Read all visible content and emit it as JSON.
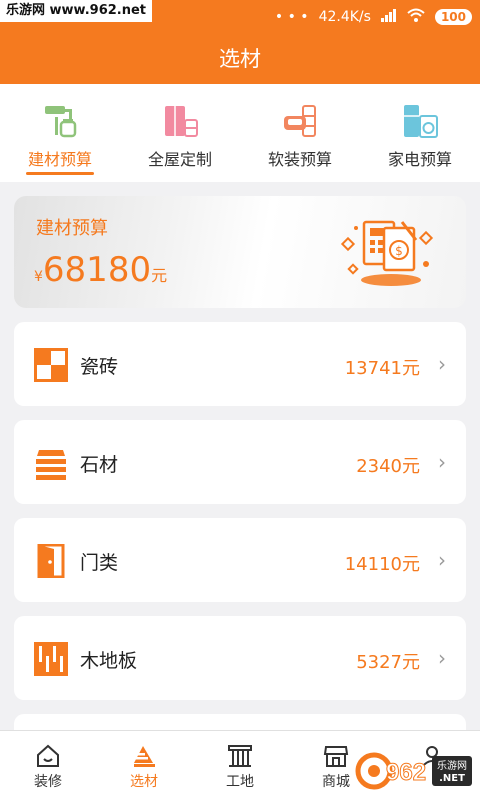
{
  "statusbar": {
    "watermark": "乐游网 www.962.net",
    "network_speed": "42.4K/s",
    "battery": "100"
  },
  "appbar": {
    "title": "选材"
  },
  "tabs": [
    {
      "label": "建材预算",
      "icon": "paint-roller-icon",
      "active": true
    },
    {
      "label": "全屋定制",
      "icon": "wardrobe-icon",
      "active": false
    },
    {
      "label": "软装预算",
      "icon": "sofa-icon",
      "active": false
    },
    {
      "label": "家电预算",
      "icon": "fridge-washer-icon",
      "active": false
    }
  ],
  "summary": {
    "title": "建材预算",
    "currency": "¥",
    "total": "68180",
    "unit": "元"
  },
  "categories": [
    {
      "name": "瓷砖",
      "value": "13741元",
      "icon": "tile-icon"
    },
    {
      "name": "石材",
      "value": "2340元",
      "icon": "stone-icon"
    },
    {
      "name": "门类",
      "value": "14110元",
      "icon": "door-icon"
    },
    {
      "name": "木地板",
      "value": "5327元",
      "icon": "wood-floor-icon"
    }
  ],
  "bottom_nav": [
    {
      "label": "装修",
      "icon": "home-icon",
      "active": false
    },
    {
      "label": "选材",
      "icon": "materials-icon",
      "active": true
    },
    {
      "label": "工地",
      "icon": "worksite-icon",
      "active": false
    },
    {
      "label": "商城",
      "icon": "shop-icon",
      "active": false
    }
  ],
  "watermark_bottom": "962 乐游网 .NET",
  "colors": {
    "accent": "#f57a1f",
    "background": "#f1f1f3"
  }
}
